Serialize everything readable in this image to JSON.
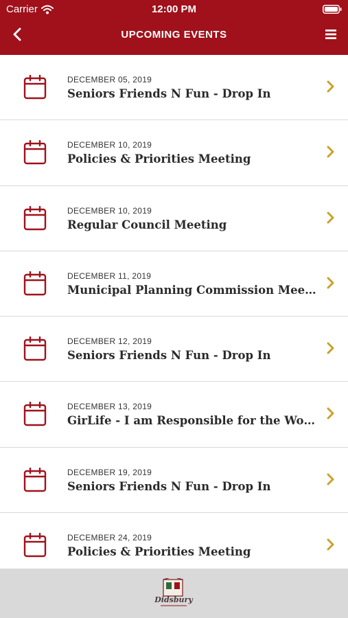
{
  "status_bar": {
    "carrier": "Carrier",
    "time": "12:00 PM",
    "wifi_icon": "wifi-icon",
    "battery_icon": "battery-icon"
  },
  "header": {
    "title": "UPCOMING EVENTS",
    "back_icon": "chevron-left-icon",
    "menu_icon": "hamburger-menu-icon",
    "background_color": "#a0111b"
  },
  "events": [
    {
      "date": "DECEMBER 05, 2019",
      "title": "Seniors Friends N Fun - Drop In"
    },
    {
      "date": "DECEMBER 10, 2019",
      "title": "Policies & Priorities Meeting"
    },
    {
      "date": "DECEMBER 10, 2019",
      "title": "Regular Council Meeting"
    },
    {
      "date": "DECEMBER 11, 2019",
      "title": "Municipal Planning Commission Meeting"
    },
    {
      "date": "DECEMBER 12, 2019",
      "title": "Seniors Friends N Fun - Drop In"
    },
    {
      "date": "DECEMBER 13, 2019",
      "title": "GirLife - I am Responsible for the World I..."
    },
    {
      "date": "DECEMBER 19, 2019",
      "title": "Seniors Friends N Fun - Drop In"
    },
    {
      "date": "DECEMBER 24, 2019",
      "title": "Policies & Priorities Meeting"
    }
  ],
  "colors": {
    "accent_red": "#a0111b",
    "chevron_gold": "#c9a227",
    "footer_gray": "#d9d9d9"
  },
  "footer": {
    "logo_text": "Didsbury"
  }
}
